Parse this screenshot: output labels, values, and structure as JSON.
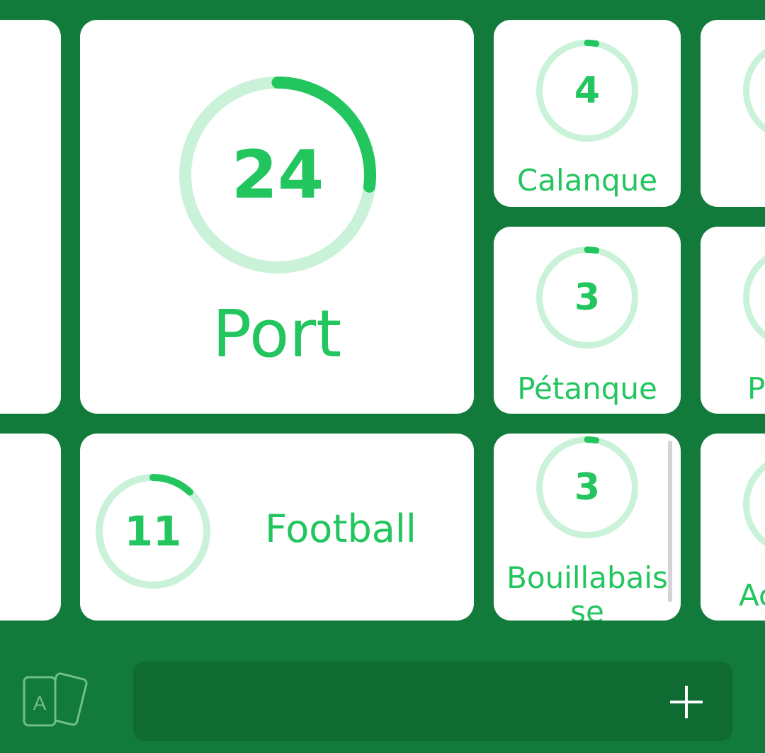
{
  "colors": {
    "background": "#127a3a",
    "card": "#ffffff",
    "accent": "#22c55e",
    "ring_track": "#c9f2d8",
    "bottom_bar": "#0f6b32"
  },
  "tiles": {
    "port": {
      "count": "24",
      "label": "Port",
      "progress": 0.27
    },
    "calanque": {
      "count": "4",
      "label": "Calanque",
      "progress": 0.03
    },
    "petanque": {
      "count": "3",
      "label": "Pétanque",
      "progress": 0.03
    },
    "football": {
      "count": "11",
      "label": "Football",
      "progress": 0.12
    },
    "bouillabaisse": {
      "count": "3",
      "label": "Bouillabaisse",
      "progress": 0.03
    },
    "partial_p": {
      "label": "P"
    },
    "partial_a": {
      "label": "Ac"
    }
  },
  "bottom": {
    "cards_icon": "cards-icon",
    "cards_icon_letter": "A",
    "add_icon": "plus-icon"
  }
}
